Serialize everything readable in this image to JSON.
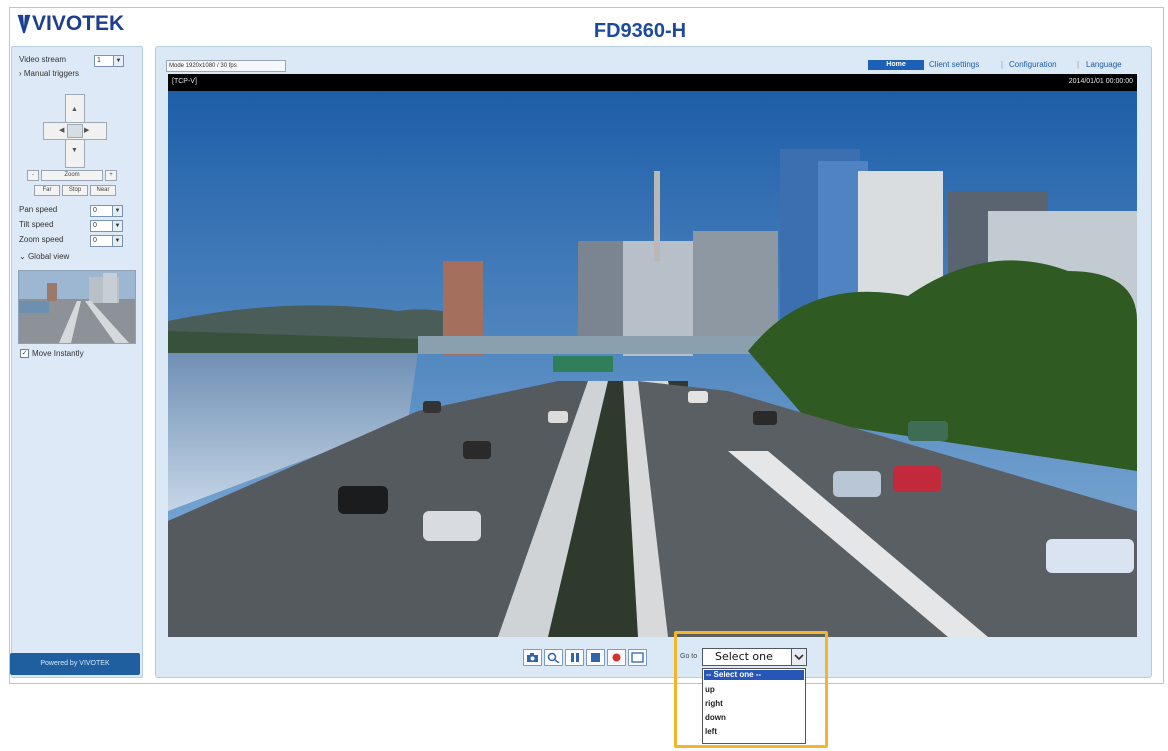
{
  "header": {
    "logo_text": "VIVOTEK",
    "model_title": "FD9360-H"
  },
  "sidebar": {
    "video_stream_label": "Video stream",
    "video_stream_value": "1",
    "manual_triggers_label": "Manual triggers",
    "zoom_out": "-",
    "zoom_label": "Zoom",
    "zoom_in": "+",
    "far_label": "Far",
    "stop_label": "Stop",
    "near_label": "Near",
    "pan_speed_label": "Pan speed",
    "pan_speed_value": "0",
    "tilt_speed_label": "Tilt speed",
    "tilt_speed_value": "0",
    "zoom_speed_label": "Zoom speed",
    "zoom_speed_value": "0",
    "global_view_label": "Global view",
    "move_instantly_label": "Move Instantly",
    "powered_by": "Powered by VIVOTEK"
  },
  "nav": {
    "home": "Home",
    "client_settings": "Client settings",
    "configuration": "Configuration",
    "language": "Language"
  },
  "video": {
    "resolution_text": "Mode 1920x1080 / 30 fps",
    "overlay_left": "[TCP-V]",
    "overlay_right": "2014/01/01 00:00:00"
  },
  "preset": {
    "label": "Go to",
    "selected": "Select one",
    "options": [
      "-- Select one --",
      "up",
      "right",
      "down",
      "left"
    ]
  },
  "colors": {
    "accent": "#1f60b7",
    "highlight": "#f2b52b",
    "panel": "#dbe8f6"
  }
}
